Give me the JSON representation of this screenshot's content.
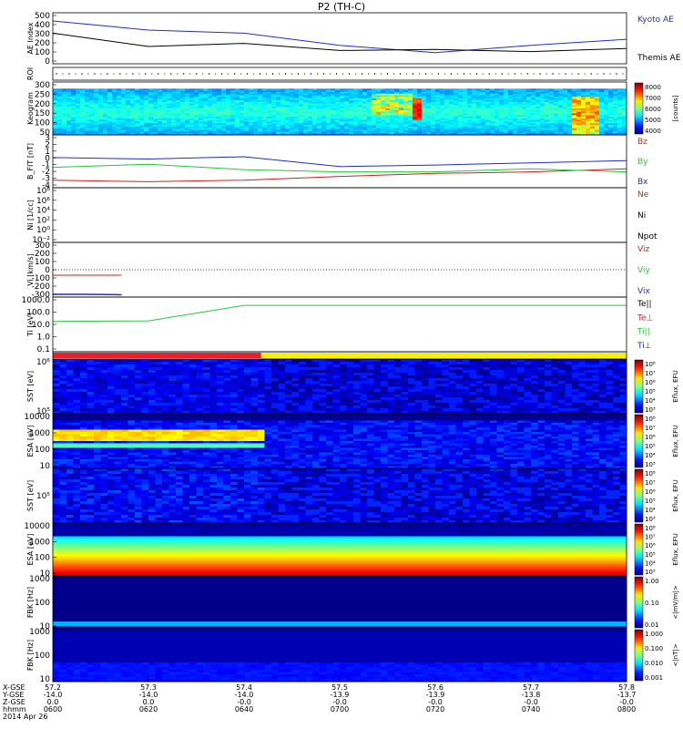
{
  "title": "P2 (TH-C)",
  "footer": {
    "rows": [
      "X-GSE",
      "Y-GSE",
      "Z-GSE",
      "hhmm",
      "2014 Apr 26"
    ],
    "columns": [
      [
        "57.2",
        "-14.0",
        "0.0",
        "0600"
      ],
      [
        "57.3",
        "-14.0",
        "0.0",
        "0620"
      ],
      [
        "57.4",
        "-14.0",
        "-0.0",
        "0640"
      ],
      [
        "57.5",
        "-13.9",
        "-0.0",
        "0700"
      ],
      [
        "57.6",
        "-13.9",
        "-0.0",
        "0720"
      ],
      [
        "57.7",
        "-13.8",
        "-0.0",
        "0740"
      ],
      [
        "57.8",
        "-13.7",
        "-0.0",
        "0800"
      ]
    ]
  },
  "colors": {
    "blue": "#1f2ec8",
    "red": "#d21e1e",
    "green": "#22c83a",
    "black": "#000000",
    "mode_red": "#e8202a",
    "mode_yellow": "#f8ee10"
  },
  "chart_data": [
    {
      "type": "line",
      "ylabel": "AE Index",
      "ylim": [
        0,
        500
      ],
      "yticks": [
        "500",
        "400",
        "300",
        "200",
        "100",
        "0"
      ],
      "x": [
        "0600",
        "0620",
        "0640",
        "0700",
        "0720",
        "0740",
        "0800"
      ],
      "series": [
        {
          "name": "Kyoto AE",
          "color": "blue",
          "values": [
            420,
            330,
            300,
            180,
            110,
            180,
            240
          ]
        },
        {
          "name": "Themis AE",
          "color": "black",
          "values": [
            300,
            170,
            200,
            130,
            140,
            120,
            150
          ]
        }
      ]
    },
    {
      "type": "bar",
      "ylabel": "ROI",
      "ylim": [
        0,
        1
      ]
    },
    {
      "type": "heatmap",
      "ylabel": "Keogram",
      "ylim": [
        0,
        300
      ],
      "yticks": [
        "300",
        "250",
        "200",
        "150",
        "100",
        "50"
      ],
      "colorbar": {
        "label": "[counts]",
        "ticks": [
          "8000",
          "7000",
          "6000",
          "5000",
          "4000"
        ]
      }
    },
    {
      "type": "line",
      "ylabel": "B_FIT [nT]",
      "ylim": [
        -4,
        3
      ],
      "yticks": [
        "3",
        "2",
        "1",
        "0",
        "-1",
        "-2",
        "-3",
        "-4"
      ],
      "x": [
        "0600",
        "0620",
        "0640",
        "0700",
        "0720",
        "0740",
        "0800"
      ],
      "series": [
        {
          "name": "Bz",
          "color": "red",
          "values": [
            -3.0,
            -3.2,
            -3.0,
            -2.5,
            -2.1,
            -1.9,
            -1.5
          ]
        },
        {
          "name": "By",
          "color": "green",
          "values": [
            -1.3,
            -0.9,
            -1.6,
            -1.9,
            -1.9,
            -1.5,
            -1.9
          ]
        },
        {
          "name": "Bx",
          "color": "blue",
          "values": [
            0.0,
            -0.2,
            0.1,
            -1.2,
            -1.0,
            -0.7,
            -0.4
          ]
        }
      ]
    },
    {
      "type": "line",
      "ylabel": "Ni [1/cc]",
      "yticks": [
        "10⁸",
        "10⁶",
        "10⁴",
        "10²",
        "10⁰",
        "10⁻²"
      ],
      "legend": [
        "Ne",
        "Ni",
        "Npot"
      ]
    },
    {
      "type": "line",
      "ylabel": "Vi [km/s]",
      "ylim": [
        -300,
        300
      ],
      "yticks": [
        "300",
        "200",
        "100",
        "0",
        "-100",
        "-200",
        "-300"
      ],
      "series": [
        {
          "name": "Viz",
          "color": "red",
          "values": [
            -60,
            -60,
            -60
          ]
        },
        {
          "name": "Viy",
          "color": "green",
          "values": []
        },
        {
          "name": "Vix",
          "color": "blue",
          "values": [
            -270,
            -270,
            -275
          ]
        }
      ]
    },
    {
      "type": "line",
      "ylabel": "Ti [eV]",
      "yticks": [
        "1000.0",
        "100.0",
        "10.0",
        "1.0",
        "0.1"
      ],
      "legend": [
        "Te||",
        "Te⊥",
        "Ti||",
        "Ti⊥"
      ],
      "series": [
        {
          "name": "Ti||",
          "color": "green",
          "values": [
            18,
            20,
            400,
            400,
            400,
            400,
            400
          ]
        }
      ]
    },
    {
      "type": "heatmap",
      "ylabel": "SST [eV]",
      "yticks": [
        "10⁶",
        "10⁵"
      ],
      "colorbar": {
        "label": "Eflux, EFU",
        "ticks": [
          "10⁸",
          "10⁷",
          "10⁶",
          "10⁵",
          "10⁴",
          "10³"
        ]
      }
    },
    {
      "type": "heatmap",
      "ylabel": "ESA [eV]",
      "yticks": [
        "10000",
        "1000",
        "100",
        "10"
      ],
      "colorbar": {
        "label": "Eflux, EFU",
        "ticks": [
          "10⁸",
          "10⁷",
          "10⁶",
          "10⁵",
          "10⁴",
          "10³"
        ]
      }
    },
    {
      "type": "heatmap",
      "ylabel": "SST [eV]",
      "yticks": [
        "10⁵"
      ],
      "colorbar": {
        "label": "Eflux, EFU",
        "ticks": [
          "10⁸",
          "10⁷",
          "10⁶",
          "10⁵",
          "10⁴",
          "10³"
        ]
      }
    },
    {
      "type": "heatmap",
      "ylabel": "ESA [eV]",
      "yticks": [
        "10000",
        "1000",
        "100",
        "10"
      ],
      "colorbar": {
        "label": "Eflux, EFU",
        "ticks": [
          "10⁸",
          "10⁷",
          "10⁶",
          "10⁵",
          "10⁴",
          "10³"
        ]
      }
    },
    {
      "type": "heatmap",
      "ylabel": "FBK [Hz]",
      "yticks": [
        "1000",
        "100",
        "10"
      ],
      "colorbar": {
        "label": "<|mV/m|>",
        "ticks": [
          "1.00",
          "0.10",
          "0.01"
        ]
      }
    },
    {
      "type": "heatmap",
      "ylabel": "FBK [Hz]",
      "yticks": [
        "1000",
        "100",
        "10"
      ],
      "colorbar": {
        "label": "<|nT|>",
        "ticks": [
          "1.000",
          "0.100",
          "0.010",
          "0.001"
        ]
      }
    }
  ]
}
